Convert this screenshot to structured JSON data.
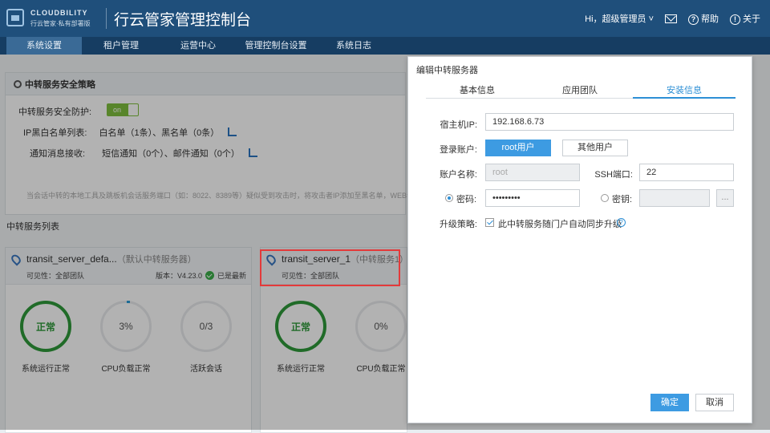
{
  "header": {
    "logo_name": "CLOUDBILITY",
    "logo_sub": "行云管家·私有部署版",
    "title": "行云管家管理控制台",
    "user": "Hi，超级管理员",
    "help": "帮助",
    "about": "关于"
  },
  "nav": [
    "系统设置",
    "租户管理",
    "运营中心",
    "管理控制台设置",
    "系统日志"
  ],
  "policy": {
    "title": "中转服务安全策略",
    "protect_label": "中转服务安全防护:",
    "toggle": "on",
    "ip_label": "IP黑白名单列表:",
    "ip_value": "白名单（1条）、黑名单（0条）",
    "notify_label": "通知消息接收:",
    "notify_value": "短信通知（0个）、邮件通知（0个）",
    "notice": "当会话中转的本地工具及跳板机会话服务端口（如：8022、8389等）疑似受到攻击时，将攻击者IP添加至黑名单，WEB会"
  },
  "list_title": "中转服务列表",
  "servers": [
    {
      "name": "transit_server_defa...",
      "tag": "（默认中转服务器）",
      "visibility": "可见性：全部团队",
      "version": "版本：V4.23.0",
      "latest": "已是最新",
      "status": "正常",
      "status_label": "系统运行正常",
      "cpu": "3%",
      "cpu_label": "CPU负载正常",
      "sessions": "0/3",
      "sessions_label": "活跃会话"
    },
    {
      "name": "transit_server_1",
      "tag": "（中转服务1）",
      "visibility": "可见性：全部团队",
      "status": "正常",
      "status_label": "系统运行正常",
      "cpu": "0%",
      "cpu_label": "CPU负载正常"
    }
  ],
  "modal": {
    "title": "编辑中转服务器",
    "tabs": [
      "基本信息",
      "应用团队",
      "安装信息"
    ],
    "host_label": "宿主机IP:",
    "host_value": "192.168.6.73",
    "account_label": "登录账户:",
    "root_btn": "root用户",
    "other_btn": "其他用户",
    "account_name_label": "账户名称:",
    "account_name_value": "root",
    "ssh_label": "SSH端口:",
    "ssh_value": "22",
    "password_label": "密码:",
    "password_value": "•••••••••",
    "key_label": "密钥:",
    "key_browse": "...",
    "upgrade_label": "升级策略:",
    "upgrade_text": "此中转服务随门户自动同步升级",
    "help_glyph": "?",
    "confirm": "确定",
    "cancel": "取消"
  },
  "colors": {
    "header_bg": "#1f4f7b",
    "accent": "#3d9be2",
    "ok_green": "#2f9a3a",
    "highlight_red": "#e33a3a"
  }
}
